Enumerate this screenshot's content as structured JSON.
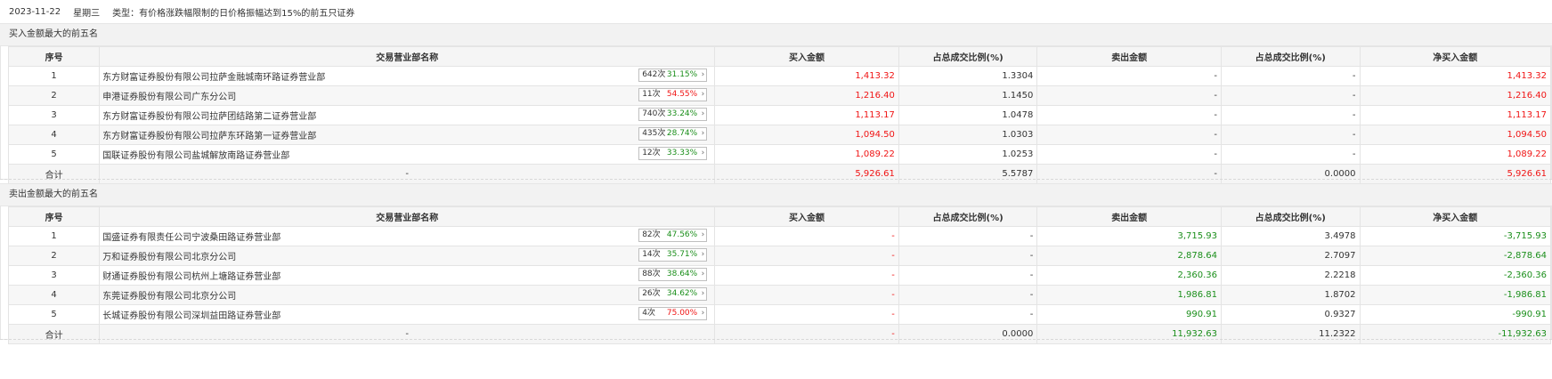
{
  "header": {
    "date": "2023-11-22",
    "weekday": "星期三",
    "type_text": "类型：有价格涨跌幅限制的日价格振幅达到15%的前五只证券"
  },
  "columns": {
    "seq": "序号",
    "broker": "交易营业部名称",
    "buy": "买入金额",
    "buy_ratio": "占总成交比例(%)",
    "sell": "卖出金额",
    "sell_ratio": "占总成交比例(%)",
    "net": "净买入金额"
  },
  "buy_section": {
    "title": "买入金额最大的前五名",
    "rows": [
      {
        "seq": "1",
        "broker": "东方财富证券股份有限公司拉萨金融城南环路证券营业部",
        "count": "642次",
        "pct": "31.15%",
        "pct_color": "green",
        "buy": "1,413.32",
        "buy_ratio": "1.3304",
        "sell": "-",
        "sell_ratio": "-",
        "net": "1,413.32"
      },
      {
        "seq": "2",
        "broker": "申港证券股份有限公司广东分公司",
        "count": "11次",
        "pct": "54.55%",
        "pct_color": "red",
        "buy": "1,216.40",
        "buy_ratio": "1.1450",
        "sell": "-",
        "sell_ratio": "-",
        "net": "1,216.40"
      },
      {
        "seq": "3",
        "broker": "东方财富证券股份有限公司拉萨团结路第二证券营业部",
        "count": "740次",
        "pct": "33.24%",
        "pct_color": "green",
        "buy": "1,113.17",
        "buy_ratio": "1.0478",
        "sell": "-",
        "sell_ratio": "-",
        "net": "1,113.17"
      },
      {
        "seq": "4",
        "broker": "东方财富证券股份有限公司拉萨东环路第一证券营业部",
        "count": "435次",
        "pct": "28.74%",
        "pct_color": "green",
        "buy": "1,094.50",
        "buy_ratio": "1.0303",
        "sell": "-",
        "sell_ratio": "-",
        "net": "1,094.50"
      },
      {
        "seq": "5",
        "broker": "国联证券股份有限公司盐城解放南路证券营业部",
        "count": "12次",
        "pct": "33.33%",
        "pct_color": "green",
        "buy": "1,089.22",
        "buy_ratio": "1.0253",
        "sell": "-",
        "sell_ratio": "-",
        "net": "1,089.22"
      }
    ],
    "total": {
      "label": "合计",
      "broker": "-",
      "buy": "5,926.61",
      "buy_ratio": "5.5787",
      "sell": "-",
      "sell_ratio": "0.0000",
      "net": "5,926.61"
    }
  },
  "sell_section": {
    "title": "卖出金额最大的前五名",
    "rows": [
      {
        "seq": "1",
        "broker": "国盛证券有限责任公司宁波桑田路证券营业部",
        "count": "82次",
        "pct": "47.56%",
        "pct_color": "green",
        "buy": "-",
        "buy_ratio": "-",
        "sell": "3,715.93",
        "sell_ratio": "3.4978",
        "net": "-3,715.93"
      },
      {
        "seq": "2",
        "broker": "万和证券股份有限公司北京分公司",
        "count": "14次",
        "pct": "35.71%",
        "pct_color": "green",
        "buy": "-",
        "buy_ratio": "-",
        "sell": "2,878.64",
        "sell_ratio": "2.7097",
        "net": "-2,878.64"
      },
      {
        "seq": "3",
        "broker": "财通证券股份有限公司杭州上塘路证券营业部",
        "count": "88次",
        "pct": "38.64%",
        "pct_color": "green",
        "buy": "-",
        "buy_ratio": "-",
        "sell": "2,360.36",
        "sell_ratio": "2.2218",
        "net": "-2,360.36"
      },
      {
        "seq": "4",
        "broker": "东莞证券股份有限公司北京分公司",
        "count": "26次",
        "pct": "34.62%",
        "pct_color": "green",
        "buy": "-",
        "buy_ratio": "-",
        "sell": "1,986.81",
        "sell_ratio": "1.8702",
        "net": "-1,986.81"
      },
      {
        "seq": "5",
        "broker": "长城证券股份有限公司深圳益田路证券营业部",
        "count": "4次",
        "pct": "75.00%",
        "pct_color": "red",
        "buy": "-",
        "buy_ratio": "-",
        "sell": "990.91",
        "sell_ratio": "0.9327",
        "net": "-990.91"
      }
    ],
    "total": {
      "label": "合计",
      "broker": "-",
      "buy": "-",
      "buy_ratio": "0.0000",
      "sell": "11,932.63",
      "sell_ratio": "11.2322",
      "net": "-11,932.63"
    }
  },
  "colors": {
    "up": "#f01414",
    "down": "#1a8e1a",
    "header_bg": "#f2f2f2"
  },
  "icons": {
    "badge_arrow": "chevron-right-icon"
  }
}
